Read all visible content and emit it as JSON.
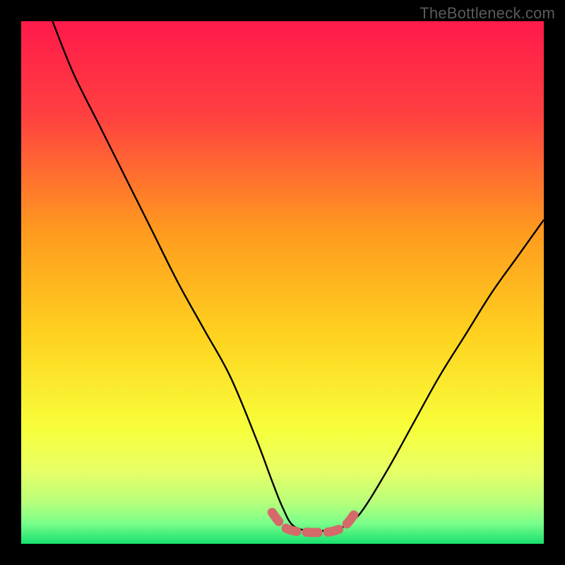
{
  "watermark": "TheBottleneck.com",
  "chart_data": {
    "type": "line",
    "title": "",
    "xlabel": "",
    "ylabel": "",
    "xlim": [
      0,
      100
    ],
    "ylim": [
      0,
      100
    ],
    "grid": false,
    "legend": false,
    "series": [
      {
        "name": "bottleneck-curve",
        "x": [
          6,
          10,
          15,
          20,
          25,
          30,
          35,
          40,
          45,
          48,
          50,
          52,
          55,
          58,
          60,
          62,
          65,
          70,
          75,
          80,
          85,
          90,
          95,
          100
        ],
        "values": [
          100,
          90,
          80,
          70,
          60,
          50,
          41,
          32,
          20,
          12,
          7,
          3.5,
          2.5,
          2.5,
          2.7,
          3.5,
          6,
          14,
          23,
          32,
          40,
          48,
          55,
          62
        ]
      },
      {
        "name": "highlight-band",
        "x": [
          48,
          50,
          52,
          55,
          58,
          60,
          62,
          64
        ],
        "values": [
          6,
          3.5,
          2.5,
          2.2,
          2.2,
          2.5,
          3.5,
          6
        ]
      }
    ],
    "background_gradient": {
      "type": "vertical",
      "stops": [
        {
          "pos": 0.0,
          "color": "#ff1a4b"
        },
        {
          "pos": 0.18,
          "color": "#ff4040"
        },
        {
          "pos": 0.4,
          "color": "#ff9a1f"
        },
        {
          "pos": 0.6,
          "color": "#ffd21f"
        },
        {
          "pos": 0.78,
          "color": "#f7ff3a"
        },
        {
          "pos": 0.86,
          "color": "#e8ff66"
        },
        {
          "pos": 0.92,
          "color": "#b8ff7a"
        },
        {
          "pos": 0.96,
          "color": "#7bff8a"
        },
        {
          "pos": 1.0,
          "color": "#18e06f"
        }
      ]
    },
    "colors": {
      "curve": "#000000",
      "highlight": "#d46a6a"
    }
  }
}
